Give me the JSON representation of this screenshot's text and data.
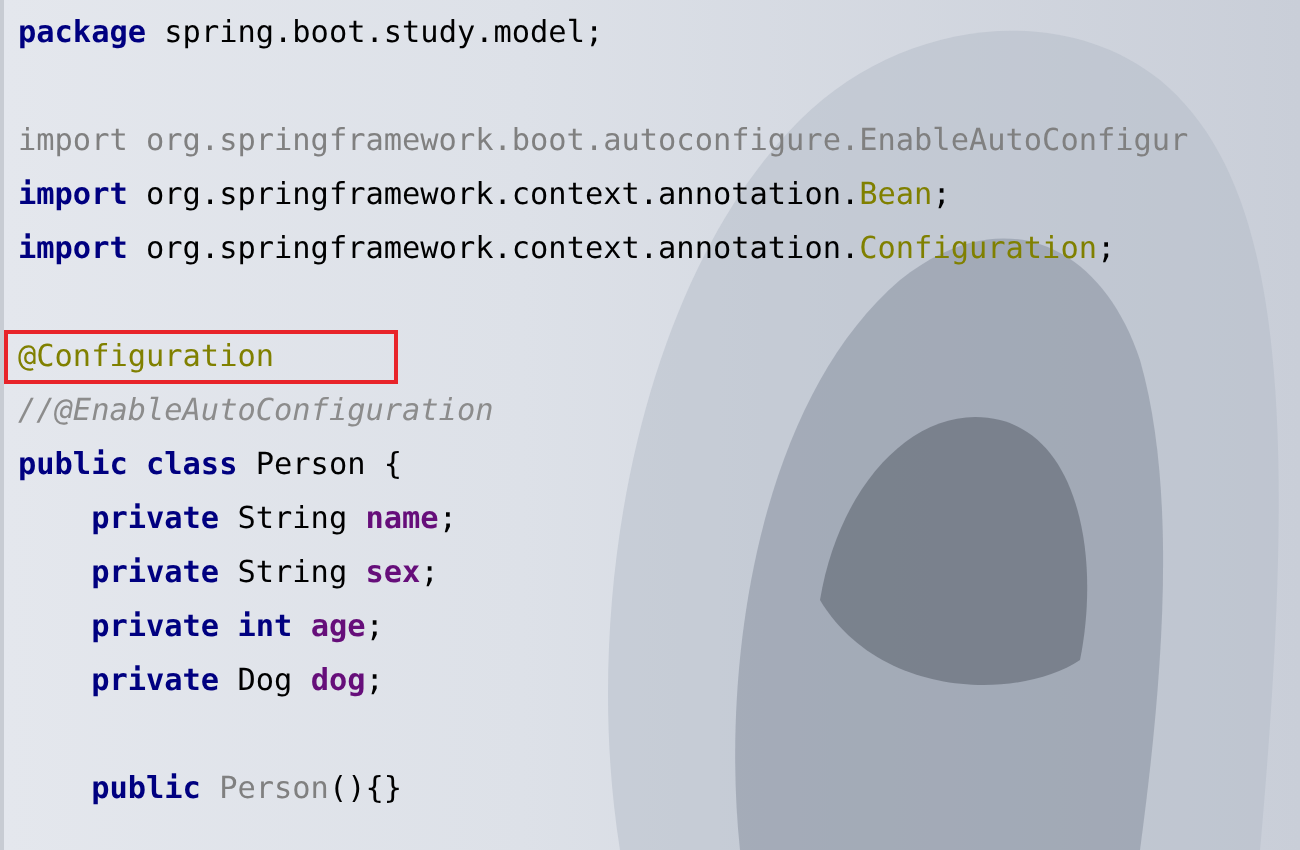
{
  "editor": {
    "lines": [
      {
        "kind": "code",
        "highlighted": false,
        "tokens": [
          {
            "text": "package",
            "kind": "keyword"
          },
          {
            "text": " spring.boot.study.model;",
            "kind": "plain"
          }
        ]
      },
      {
        "kind": "blank"
      },
      {
        "kind": "code",
        "highlighted": false,
        "tokens": [
          {
            "text": "import org.springframework.boot.autoconfigure.EnableAutoConfigur",
            "kind": "unused"
          }
        ]
      },
      {
        "kind": "code",
        "highlighted": false,
        "tokens": [
          {
            "text": "import",
            "kind": "keyword"
          },
          {
            "text": " org.springframework.context.annotation.",
            "kind": "plain"
          },
          {
            "text": "Bean",
            "kind": "annotation"
          },
          {
            "text": ";",
            "kind": "plain"
          }
        ]
      },
      {
        "kind": "code",
        "highlighted": false,
        "tokens": [
          {
            "text": "import",
            "kind": "keyword"
          },
          {
            "text": " org.springframework.context.annotation.",
            "kind": "plain"
          },
          {
            "text": "Configuration",
            "kind": "annotation"
          },
          {
            "text": ";",
            "kind": "plain"
          }
        ]
      },
      {
        "kind": "blank"
      },
      {
        "kind": "code",
        "highlighted": true,
        "tokens": [
          {
            "text": "@Configuration",
            "kind": "annotation"
          }
        ]
      },
      {
        "kind": "code",
        "highlighted": false,
        "tokens": [
          {
            "text": "//@EnableAutoConfiguration",
            "kind": "comment"
          }
        ]
      },
      {
        "kind": "code",
        "highlighted": false,
        "tokens": [
          {
            "text": "public class",
            "kind": "keyword"
          },
          {
            "text": " Person {",
            "kind": "plain"
          }
        ]
      },
      {
        "kind": "code",
        "highlighted": false,
        "tokens": [
          {
            "text": "    private",
            "kind": "keyword"
          },
          {
            "text": " String ",
            "kind": "plain"
          },
          {
            "text": "name",
            "kind": "field"
          },
          {
            "text": ";",
            "kind": "plain"
          }
        ]
      },
      {
        "kind": "code",
        "highlighted": false,
        "tokens": [
          {
            "text": "    private",
            "kind": "keyword"
          },
          {
            "text": " String ",
            "kind": "plain"
          },
          {
            "text": "sex",
            "kind": "field"
          },
          {
            "text": ";",
            "kind": "plain"
          }
        ]
      },
      {
        "kind": "code",
        "highlighted": false,
        "tokens": [
          {
            "text": "    private int ",
            "kind": "keyword"
          },
          {
            "text": "age",
            "kind": "field"
          },
          {
            "text": ";",
            "kind": "plain"
          }
        ]
      },
      {
        "kind": "code",
        "highlighted": false,
        "tokens": [
          {
            "text": "    private",
            "kind": "keyword"
          },
          {
            "text": " Dog ",
            "kind": "plain"
          },
          {
            "text": "dog",
            "kind": "field"
          },
          {
            "text": ";",
            "kind": "plain"
          }
        ]
      },
      {
        "kind": "blank"
      },
      {
        "kind": "code",
        "highlighted": false,
        "tokens": [
          {
            "text": "    public ",
            "kind": "keyword"
          },
          {
            "text": "Person",
            "kind": "unused"
          },
          {
            "text": "(){}",
            "kind": "plain"
          }
        ]
      }
    ]
  }
}
